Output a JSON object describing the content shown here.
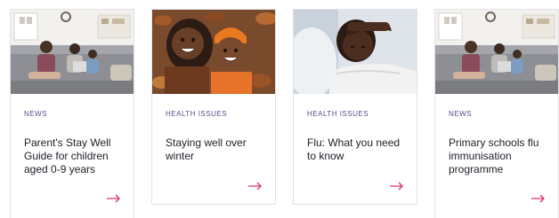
{
  "cards": [
    {
      "image": "family-on-sofa",
      "category": "NEWS",
      "title": "Parent's Stay Well Guide for children aged 0-9 years",
      "arrow_icon": "arrow-right-icon"
    },
    {
      "image": "children-in-autumn-leaves",
      "category": "HEALTH ISSUES",
      "title": "Staying well over winter",
      "arrow_icon": "arrow-right-icon"
    },
    {
      "image": "sick-child-in-bed",
      "category": "HEALTH ISSUES",
      "title": "Flu: What you need to know",
      "arrow_icon": "arrow-right-icon"
    },
    {
      "image": "family-on-sofa",
      "category": "NEWS",
      "title": "Primary schools flu immunisation programme",
      "arrow_icon": "arrow-right-icon"
    }
  ],
  "colors": {
    "category": "#5a4d8c",
    "arrow": "#e0306a",
    "title": "#1e1e28",
    "border": "#e2e2e8"
  }
}
